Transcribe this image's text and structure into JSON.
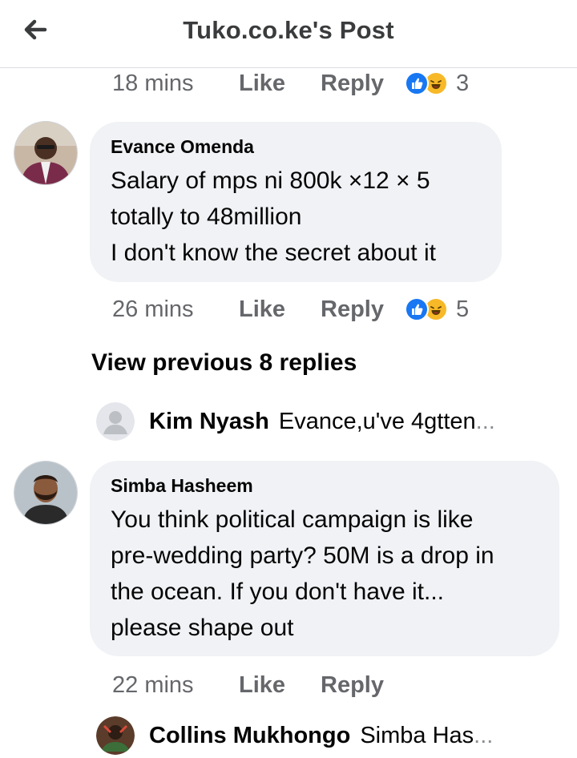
{
  "header": {
    "title": "Tuko.co.ke's Post",
    "back_icon": "arrow-left-icon"
  },
  "comments": [
    {
      "time": "18 mins",
      "like": "Like",
      "reply": "Reply",
      "reaction_count": "3"
    },
    {
      "author": "Evance Omenda",
      "lines": [
        "Salary of mps ni 800k ×12 × 5",
        "totally to 48million",
        "I don't know the secret about it"
      ],
      "time": "26 mins",
      "like": "Like",
      "reply": "Reply",
      "reaction_count": "5"
    },
    {
      "author": "Simba Hasheem",
      "lines": [
        "You think political campaign is like",
        "pre-wedding party? 50M is a drop in",
        "the ocean. If you don't have it...",
        "please shape out"
      ],
      "time": "22 mins",
      "like": "Like",
      "reply": "Reply"
    }
  ],
  "view_previous": "View previous 8 replies",
  "reply_previews": [
    {
      "name": "Kim Nyash",
      "text": "Evance,u've 4gtten",
      "ellipsis": "..."
    },
    {
      "name": "Collins Mukhongo",
      "text": "Simba Has",
      "ellipsis": "..."
    }
  ],
  "colors": {
    "like_blue": "#1877f2",
    "haha_yellow": "#f7b928",
    "bubble_bg": "#f0f2f5",
    "meta_gray": "#65676b"
  }
}
